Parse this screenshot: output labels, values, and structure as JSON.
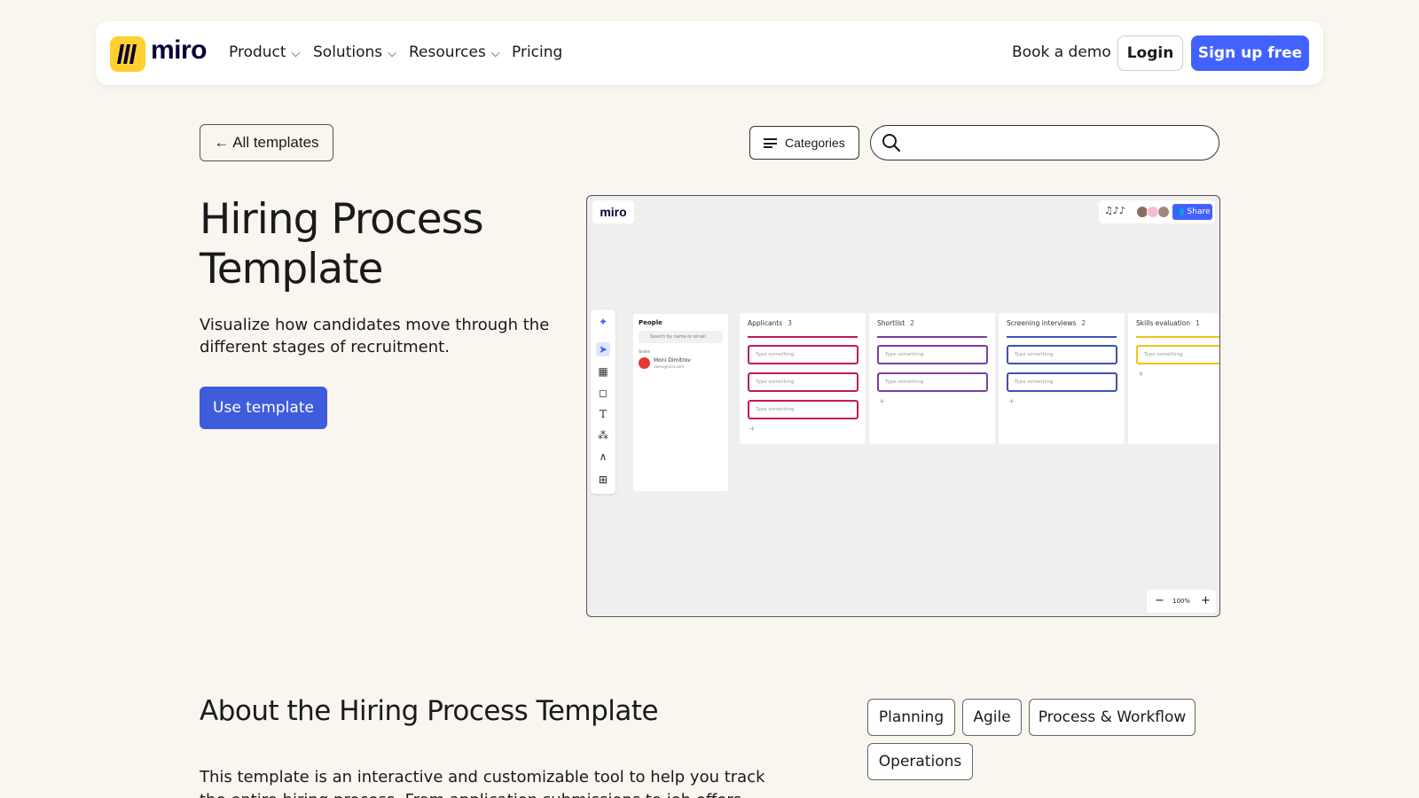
{
  "nav": {
    "logo_text": "miro",
    "items": [
      {
        "label": "Product",
        "has_dropdown": true
      },
      {
        "label": "Solutions",
        "has_dropdown": true
      },
      {
        "label": "Resources",
        "has_dropdown": true
      },
      {
        "label": "Pricing",
        "has_dropdown": false
      }
    ],
    "book_demo": "Book a demo",
    "login": "Login",
    "signup": "Sign up free"
  },
  "subbar": {
    "back_label": "← All templates",
    "categories_label": "Categories",
    "search_placeholder": "",
    "search_value": ""
  },
  "hero": {
    "title": "Hiring Process Template",
    "description": "Visualize how candidates move through the different stages of recruitment.",
    "cta": "Use template"
  },
  "preview": {
    "logo": "miro",
    "share": "Share",
    "people_title": "People",
    "people_search": "Search by name or email",
    "people_group": "Online",
    "person_name": "Moni Dimitrov",
    "person_email": "name@miro.com",
    "columns": [
      {
        "title": "Applicants",
        "count": "3",
        "color": "#c2185b",
        "cards": [
          "Type something",
          "Type something",
          "Type something"
        ]
      },
      {
        "title": "Shortlist",
        "count": "2",
        "color": "#7b3fa0",
        "cards": [
          "Type something",
          "Type something"
        ]
      },
      {
        "title": "Screening interviews",
        "count": "2",
        "color": "#3f51b5",
        "cards": [
          "Type something",
          "Type something"
        ]
      },
      {
        "title": "Skills evaluation",
        "count": "1",
        "color": "#f2c21b",
        "cards": [
          "Type something"
        ]
      }
    ],
    "zoom": "100%"
  },
  "about": {
    "title": "About the Hiring Process Template",
    "body": "This template is an interactive and customizable tool to help you track the entire hiring process. From application submissions to job offers,",
    "tags": [
      "Planning",
      "Agile",
      "Process & Workflow",
      "Operations"
    ]
  },
  "colors": {
    "background": "#f9f6ef",
    "primary": "#4262ff",
    "cta": "#3f5cdc",
    "logo_yellow": "#ffd02f"
  }
}
